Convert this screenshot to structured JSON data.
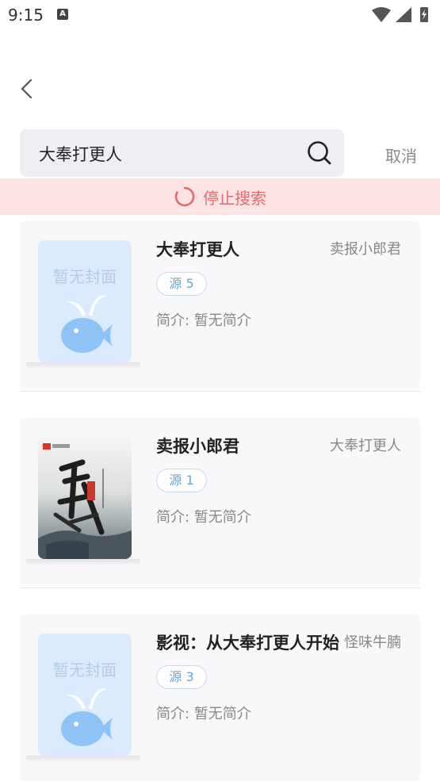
{
  "status_bar": {
    "time": "9:15",
    "notification_icon": "A"
  },
  "header": {
    "back_icon": "chevron-left-icon"
  },
  "search": {
    "query": "大奉打更人",
    "cancel_label": "取消"
  },
  "stop_bar": {
    "label": "停止搜索"
  },
  "results": [
    {
      "title": "大奉打更人",
      "author": "卖报小郎君",
      "source": "源  5",
      "intro": "简介: 暂无简介",
      "cover_text": "暂无封面",
      "cover_type": "placeholder"
    },
    {
      "title": "卖报小郎君",
      "author": "大奉打更人",
      "source": "源  1",
      "intro": "简介: 暂无简介",
      "cover_text": "",
      "cover_type": "image"
    },
    {
      "title": "影视：从大奉打更人开始",
      "author": "怪味牛腩",
      "source": "源  3",
      "intro": "简介: 暂无简介",
      "cover_text": "暂无封面",
      "cover_type": "placeholder"
    }
  ],
  "colors": {
    "accent": "#e06b6b",
    "stop_bg": "#fde3e4",
    "tag_border": "#c9dbea",
    "tag_text": "#6ea3cd",
    "cover_bg": "#dbeafc",
    "fish": "#8ec3f5"
  }
}
